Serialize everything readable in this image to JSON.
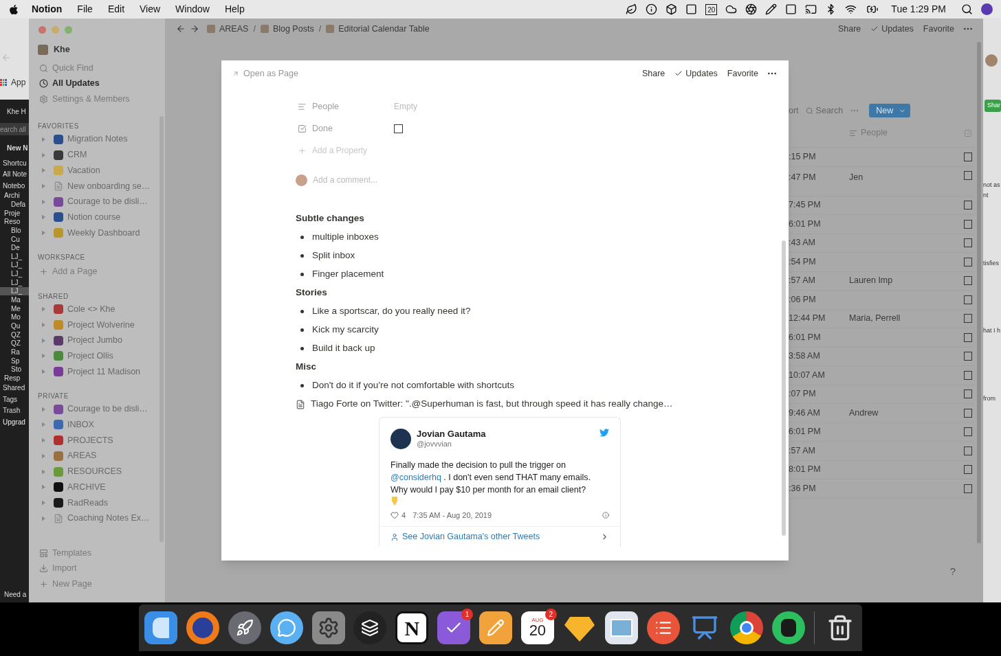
{
  "menu_bar": {
    "app": "Notion",
    "menus": [
      "File",
      "Edit",
      "View",
      "Window",
      "Help"
    ],
    "calendar_day": "20",
    "clock": "Tue 1:29 PM"
  },
  "left_app": {
    "browser_label": "App",
    "items": [
      {
        "kind": "account",
        "text": "Khe H",
        "selected": false
      },
      {
        "kind": "search",
        "text": "earch all",
        "selected": false
      },
      {
        "kind": "new",
        "text": "New N",
        "selected": false
      },
      {
        "kind": "item",
        "text": "Shortcu",
        "selected": false
      },
      {
        "kind": "item",
        "text": "All Note",
        "selected": false
      },
      {
        "kind": "item",
        "text": "Notebo",
        "selected": false
      },
      {
        "kind": "folder",
        "text": "Archi",
        "selected": false
      },
      {
        "kind": "note",
        "text": "Defa",
        "selected": false
      },
      {
        "kind": "folder",
        "text": "Proje",
        "selected": false
      },
      {
        "kind": "folder",
        "text": "Reso",
        "selected": false
      },
      {
        "kind": "note",
        "text": "Blo",
        "selected": false
      },
      {
        "kind": "note",
        "text": "Cu",
        "selected": false
      },
      {
        "kind": "note",
        "text": "De",
        "selected": false
      },
      {
        "kind": "note",
        "text": "LJ_",
        "selected": false
      },
      {
        "kind": "note",
        "text": "LJ_",
        "selected": false
      },
      {
        "kind": "note",
        "text": "LJ_",
        "selected": false
      },
      {
        "kind": "note",
        "text": "LJ_",
        "selected": false
      },
      {
        "kind": "note",
        "text": "LJ_",
        "selected": true
      },
      {
        "kind": "note",
        "text": "Ma",
        "selected": false
      },
      {
        "kind": "note",
        "text": "Me",
        "selected": false
      },
      {
        "kind": "note",
        "text": "Mo",
        "selected": false
      },
      {
        "kind": "note",
        "text": "Qu",
        "selected": false
      },
      {
        "kind": "note",
        "text": "QZ",
        "selected": false
      },
      {
        "kind": "note",
        "text": "QZ",
        "selected": false
      },
      {
        "kind": "note",
        "text": "Ra",
        "selected": false
      },
      {
        "kind": "note",
        "text": "Sp",
        "selected": false
      },
      {
        "kind": "note",
        "text": "Sto",
        "selected": false
      },
      {
        "kind": "folder",
        "text": "Resp",
        "selected": false
      },
      {
        "kind": "item",
        "text": "Shared",
        "selected": false
      },
      {
        "kind": "item",
        "text": "Tags",
        "selected": false
      },
      {
        "kind": "item",
        "text": "Trash",
        "selected": false
      },
      {
        "kind": "upgrade",
        "text": "Upgrad",
        "selected": false
      }
    ],
    "footer": "Need a"
  },
  "right_app": {
    "button": "Shar",
    "texts": [
      "not as",
      "nt",
      "tisfies",
      "hat I h",
      "from"
    ]
  },
  "topbar": {
    "breadcrumbs": [
      {
        "kind": "page",
        "label": "AREAS"
      },
      {
        "kind": "separator",
        "label": "/"
      },
      {
        "kind": "page",
        "label": "Blog Posts"
      },
      {
        "kind": "separator",
        "label": "/"
      },
      {
        "kind": "page",
        "label": "Editorial Calendar Table"
      }
    ],
    "actions": [
      "Share",
      "Updates",
      "Favorite"
    ]
  },
  "sidebar": {
    "workspace": "Khe",
    "nav": [
      {
        "label": "Quick Find",
        "selected": false
      },
      {
        "label": "All Updates",
        "selected": true
      },
      {
        "label": "Settings & Members",
        "selected": false
      }
    ],
    "sections": [
      {
        "title": "FAVORITES",
        "items": [
          {
            "kind": "emoji",
            "label": "Migration Notes",
            "color": "#2a4f8f"
          },
          {
            "kind": "emoji",
            "label": "CRM",
            "color": "#3a3a3a"
          },
          {
            "kind": "emoji",
            "label": "Vacation",
            "color": "#c9a94a"
          },
          {
            "kind": "doc",
            "label": "New onboarding se…"
          },
          {
            "kind": "emoji",
            "label": "Courage to be disli…",
            "color": "#7a4a9a"
          },
          {
            "kind": "emoji",
            "label": "Notion course",
            "color": "#2a4f8f"
          },
          {
            "kind": "emoji",
            "label": "Weekly Dashboard",
            "color": "#b8962a"
          }
        ]
      },
      {
        "title": "WORKSPACE",
        "items": [
          {
            "kind": "add",
            "label": "Add a Page"
          }
        ]
      },
      {
        "title": "SHARED",
        "items": [
          {
            "kind": "emoji",
            "label": "Cole <> Khe",
            "color": "#a83a3a"
          },
          {
            "kind": "emoji",
            "label": "Project Wolverine",
            "color": "#c08a2a"
          },
          {
            "kind": "emoji",
            "label": "Project Jumbo",
            "color": "#5a3a6a"
          },
          {
            "kind": "emoji",
            "label": "Project Ollis",
            "color": "#4a8a3a"
          },
          {
            "kind": "emoji",
            "label": "Project 11 Madison",
            "color": "#7a3a9a"
          }
        ]
      },
      {
        "title": "PRIVATE",
        "items": [
          {
            "kind": "emoji",
            "label": "Courage to be disli…",
            "color": "#7a4a9a"
          },
          {
            "kind": "emoji",
            "label": "INBOX",
            "color": "#3a6ab0"
          },
          {
            "kind": "emoji",
            "label": "PROJECTS",
            "color": "#b03030"
          },
          {
            "kind": "emoji",
            "label": "AREAS",
            "color": "#9a7040"
          },
          {
            "kind": "emoji",
            "label": "RESOURCES",
            "color": "#6a9a3a"
          },
          {
            "kind": "emoji",
            "label": "ARCHIVE",
            "color": "#111111"
          },
          {
            "kind": "emoji",
            "label": "RadReads",
            "color": "#1a1a1a"
          },
          {
            "kind": "doc",
            "label": "Coaching Notes Ex…"
          }
        ]
      }
    ],
    "footer": [
      "Templates",
      "Import",
      "New Page"
    ]
  },
  "table": {
    "sort": "ort",
    "search": "Search",
    "new": "New",
    "column": "People",
    "rows": [
      {
        "time": ":15 PM",
        "done": false
      },
      {
        "time": ":47 PM",
        "people": "Jen",
        "done": false
      },
      {
        "time": "7:45 PM",
        "done": false
      },
      {
        "time": "6:01 PM",
        "done": false
      },
      {
        "time": ":43 AM",
        "done": false
      },
      {
        "time": ":54 PM",
        "done": false
      },
      {
        "time": ":57 AM",
        "people": "Lauren Imp",
        "done": false
      },
      {
        "time": ":06 PM",
        "done": false
      },
      {
        "time": "12:44 PM",
        "people": "Maria, Perrell",
        "done": false
      },
      {
        "time": "6:01 PM",
        "done": false
      },
      {
        "time": "3:58 AM",
        "done": false
      },
      {
        "time": "10:07 AM",
        "done": false
      },
      {
        "time": ":07 PM",
        "done": false
      },
      {
        "time": "9:46 AM",
        "people": "Andrew",
        "done": false
      },
      {
        "time": "6:01 PM",
        "done": false
      },
      {
        "time": ":57 AM",
        "done": false
      },
      {
        "time": "8:01 PM",
        "done": false
      },
      {
        "time": ":36 PM",
        "done": false
      }
    ]
  },
  "help": "?",
  "modal": {
    "open_as_page": "Open as Page",
    "actions": [
      "Share",
      "Updates",
      "Favorite"
    ],
    "properties": [
      {
        "kind": "text",
        "name": "People",
        "value": "Empty"
      },
      {
        "kind": "checkbox",
        "name": "Done",
        "checked": false
      }
    ],
    "add_property": "Add a Property",
    "comment_placeholder": "Add a comment...",
    "blocks": [
      {
        "kind": "heading",
        "text": "Subtle changes"
      },
      {
        "kind": "bullet",
        "text": "multiple inboxes"
      },
      {
        "kind": "bullet",
        "text": "Split inbox"
      },
      {
        "kind": "bullet",
        "text": "Finger placement"
      },
      {
        "kind": "heading",
        "text": "Stories"
      },
      {
        "kind": "bullet",
        "text": "Like a sportscar, do you really need it?"
      },
      {
        "kind": "bullet",
        "text": "Kick my scarcity"
      },
      {
        "kind": "bullet",
        "text": "Build it back up"
      },
      {
        "kind": "heading",
        "text": "Misc"
      },
      {
        "kind": "bullet",
        "text": "Don't do it if you're not comfortable with shortcuts"
      },
      {
        "kind": "bookmark",
        "text": "Tiago Forte on Twitter: \".@Superhuman is fast, but through speed it has really change…"
      }
    ],
    "tweet": {
      "name": "Jovian Gautama",
      "handle": "@jovvvian",
      "body": [
        {
          "kind": "text",
          "text": "Finally made the decision to pull the trigger on "
        },
        {
          "kind": "mention",
          "text": "@considerhq"
        },
        {
          "kind": "text",
          "text": " . I don't even send THAT many emails. Why would I pay $10 per month for an email client?"
        }
      ],
      "likes": "4",
      "time": "7:35 AM - Aug 20, 2019",
      "more": "See Jovian Gautama's other Tweets"
    }
  },
  "dock": [
    {
      "kind": "finder"
    },
    {
      "kind": "firefox"
    },
    {
      "kind": "rocket"
    },
    {
      "kind": "messages"
    },
    {
      "kind": "settings"
    },
    {
      "kind": "layers"
    },
    {
      "kind": "notion",
      "label": "N"
    },
    {
      "kind": "tasks",
      "badge": "1"
    },
    {
      "kind": "pen"
    },
    {
      "kind": "calendar",
      "month": "AUG",
      "label": "20",
      "badge": "2"
    },
    {
      "kind": "sketch"
    },
    {
      "kind": "preview"
    },
    {
      "kind": "list"
    },
    {
      "kind": "keynote"
    },
    {
      "kind": "chrome"
    },
    {
      "kind": "evernote"
    },
    {
      "kind": "trash"
    }
  ]
}
